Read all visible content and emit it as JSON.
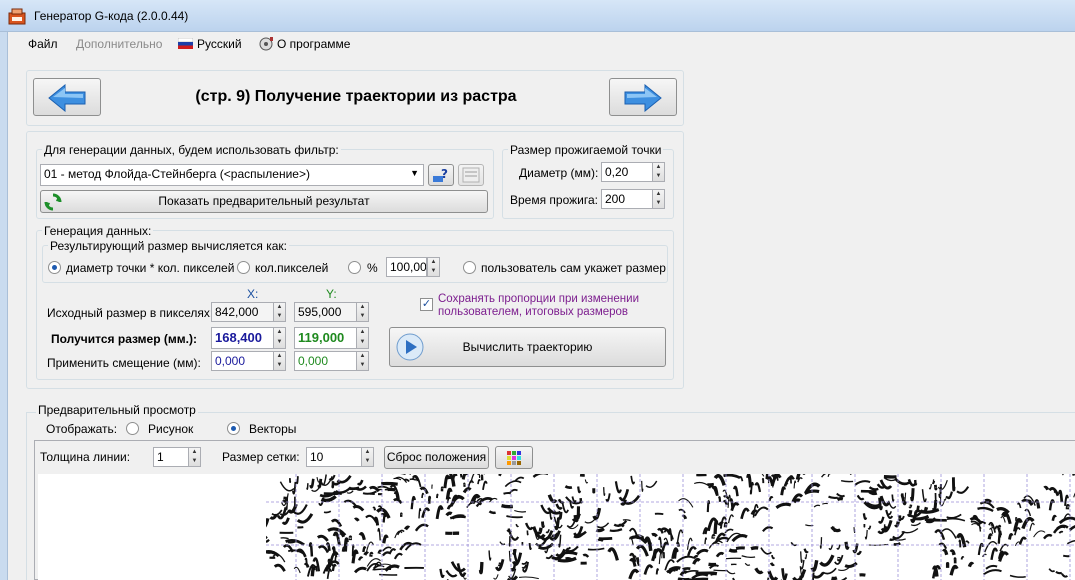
{
  "window": {
    "title": "Генератор G-кода (2.0.0.44)"
  },
  "menu": {
    "file": "Файл",
    "advanced": "Дополнительно",
    "language": "Русский",
    "about": "О программе"
  },
  "header": {
    "page_title": "(стр. 9) Получение траектории из растра",
    "back_icon": "arrow-left-icon",
    "next_icon": "arrow-right-icon"
  },
  "filter": {
    "group_label": "Для генерации данных, будем использовать фильтр:",
    "selected": "01 - метод Флойда-Стейнберга (<распыление>)",
    "preview_button": "Показать предварительный результат"
  },
  "dot": {
    "group_label": "Размер прожигаемой точки",
    "diameter_label": "Диаметр (мм):",
    "diameter_value": "0,20",
    "burn_time_label": "Время прожига:",
    "burn_time_value": "200"
  },
  "generation": {
    "group_label": "Генерация данных:",
    "result_group_label": "Результирующий размер вычисляется как:",
    "options": [
      {
        "label": "диаметр точки * кол. пикселей",
        "selected": true
      },
      {
        "label": "кол.пикселей",
        "selected": false
      },
      {
        "label": "%",
        "selected": false
      },
      {
        "label": "пользователь сам укажет размер",
        "selected": false
      }
    ],
    "percent_value": "100,00",
    "x_header": "X:",
    "y_header": "Y:",
    "source_size_label": "Исходный размер в пикселях:",
    "source_x": "842,000",
    "source_y": "595,000",
    "result_size_label": "Получится размер (мм.):",
    "result_x": "168,400",
    "result_y": "119,000",
    "offset_label": "Применить смещение (мм):",
    "offset_x": "0,000",
    "offset_y": "0,000",
    "keep_proportions_label": "Сохранять пропорции при изменении пользователем, итоговых размеров",
    "keep_proportions_checked": true,
    "calc_button": "Вычислить траекторию"
  },
  "preview": {
    "group_label": "Предварительный просмотр",
    "display_label": "Отображать:",
    "display_options": [
      {
        "label": "Рисунок",
        "selected": false
      },
      {
        "label": "Векторы",
        "selected": true
      }
    ],
    "line_width_label": "Толщина линии:",
    "line_width_value": "1",
    "grid_size_label": "Размер сетки:",
    "grid_size_value": "10",
    "reset_button": "Сброс положения"
  },
  "colors": {
    "accent_blue": "#1a1a9c",
    "accent_green": "#1f8a1f",
    "purple_text": "#7d1f8f"
  }
}
